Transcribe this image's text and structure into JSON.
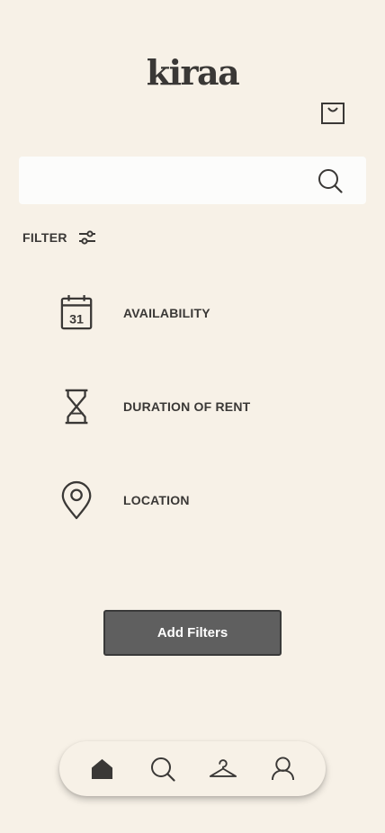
{
  "app": {
    "logo": "kiraa"
  },
  "header": {
    "bag_icon": "shopping-bag-icon"
  },
  "search": {
    "placeholder": "",
    "icon": "search-icon"
  },
  "filter": {
    "label": "FILTER",
    "icon": "sliders-icon"
  },
  "options": [
    {
      "label": "AVAILABILITY",
      "icon": "calendar-icon",
      "calendar_day": "31"
    },
    {
      "label": "DURATION OF RENT",
      "icon": "hourglass-icon"
    },
    {
      "label": "LOCATION",
      "icon": "location-pin-icon"
    }
  ],
  "add_filters": {
    "label": "Add Filters"
  },
  "bottom_nav": [
    {
      "id": "home",
      "icon": "home-icon",
      "active": true
    },
    {
      "id": "search",
      "icon": "search-icon"
    },
    {
      "id": "wardrobe",
      "icon": "hanger-icon"
    },
    {
      "id": "profile",
      "icon": "user-icon"
    }
  ],
  "colors": {
    "background": "#f7f1e7",
    "text": "#3a3836",
    "button": "#5f5f5f"
  }
}
